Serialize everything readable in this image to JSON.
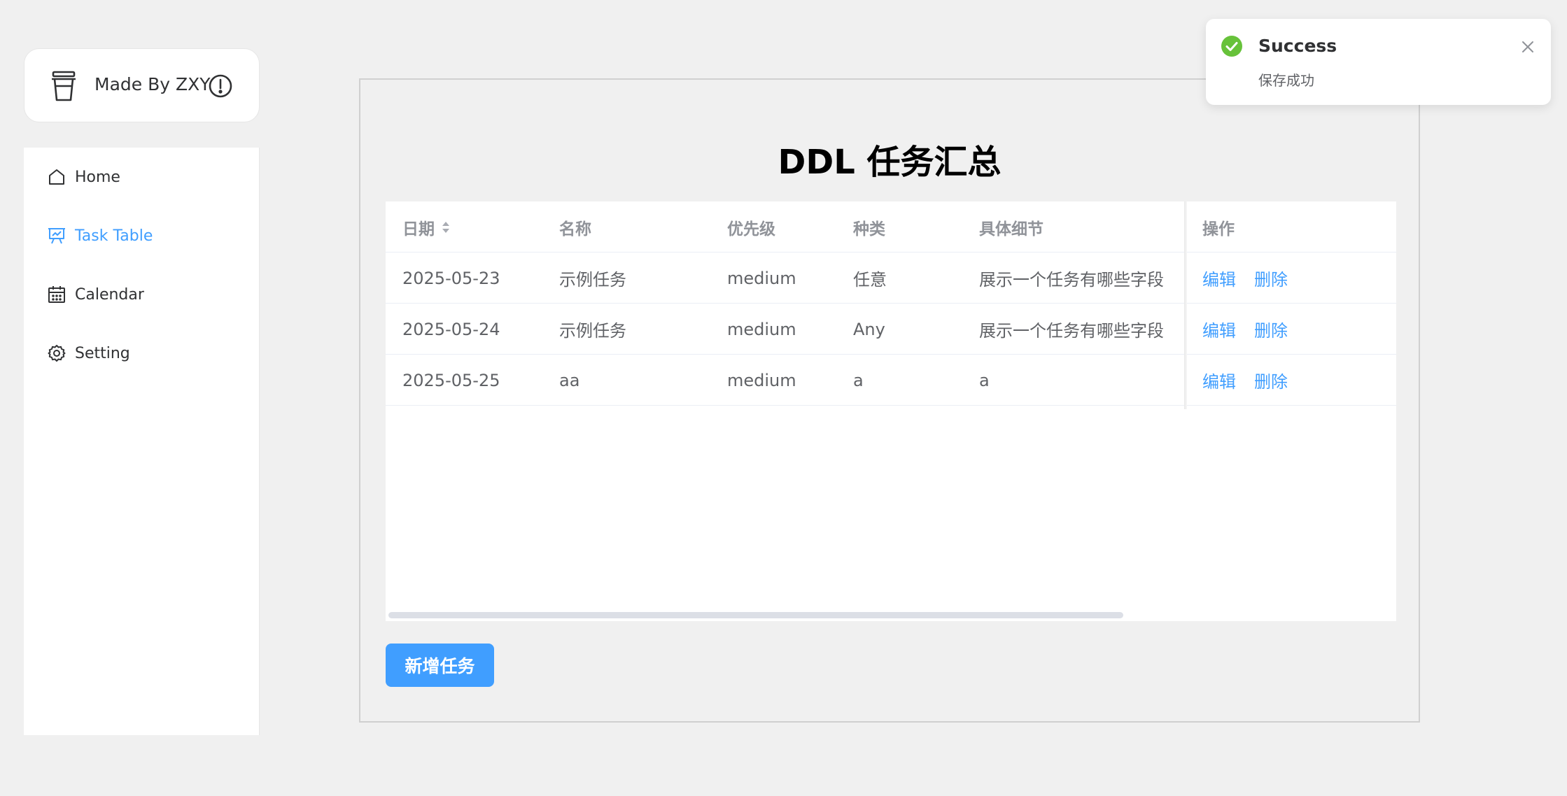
{
  "brand": {
    "text": "Made By ZXY",
    "icon": "cup-icon",
    "info_icon": "info-icon"
  },
  "sidebar": {
    "items": [
      {
        "label": "Home",
        "icon": "home-icon",
        "active": false
      },
      {
        "label": "Task Table",
        "icon": "presentation-icon",
        "active": true
      },
      {
        "label": "Calendar",
        "icon": "calendar-icon",
        "active": false
      },
      {
        "label": "Setting",
        "icon": "gear-icon",
        "active": false
      }
    ]
  },
  "main": {
    "title": "DDL 任务汇总",
    "table": {
      "headers": [
        "日期",
        "名称",
        "优先级",
        "种类",
        "具体细节",
        "操作"
      ],
      "rows": [
        {
          "date": "2025-05-23",
          "name": "示例任务",
          "priority": "medium",
          "type": "任意",
          "detail": "展示一个任务有哪些字段"
        },
        {
          "date": "2025-05-24",
          "name": "示例任务",
          "priority": "medium",
          "type": "Any",
          "detail": "展示一个任务有哪些字段"
        },
        {
          "date": "2025-05-25",
          "name": "aa",
          "priority": "medium",
          "type": "a",
          "detail": "a"
        }
      ],
      "edit_label": "编辑",
      "delete_label": "删除"
    },
    "add_button": "新增任务"
  },
  "toast": {
    "title": "Success",
    "message": "保存成功",
    "icon": "check-circle-icon"
  },
  "colors": {
    "accent": "#409eff",
    "success": "#67c23a",
    "background": "#f0f0f0"
  }
}
